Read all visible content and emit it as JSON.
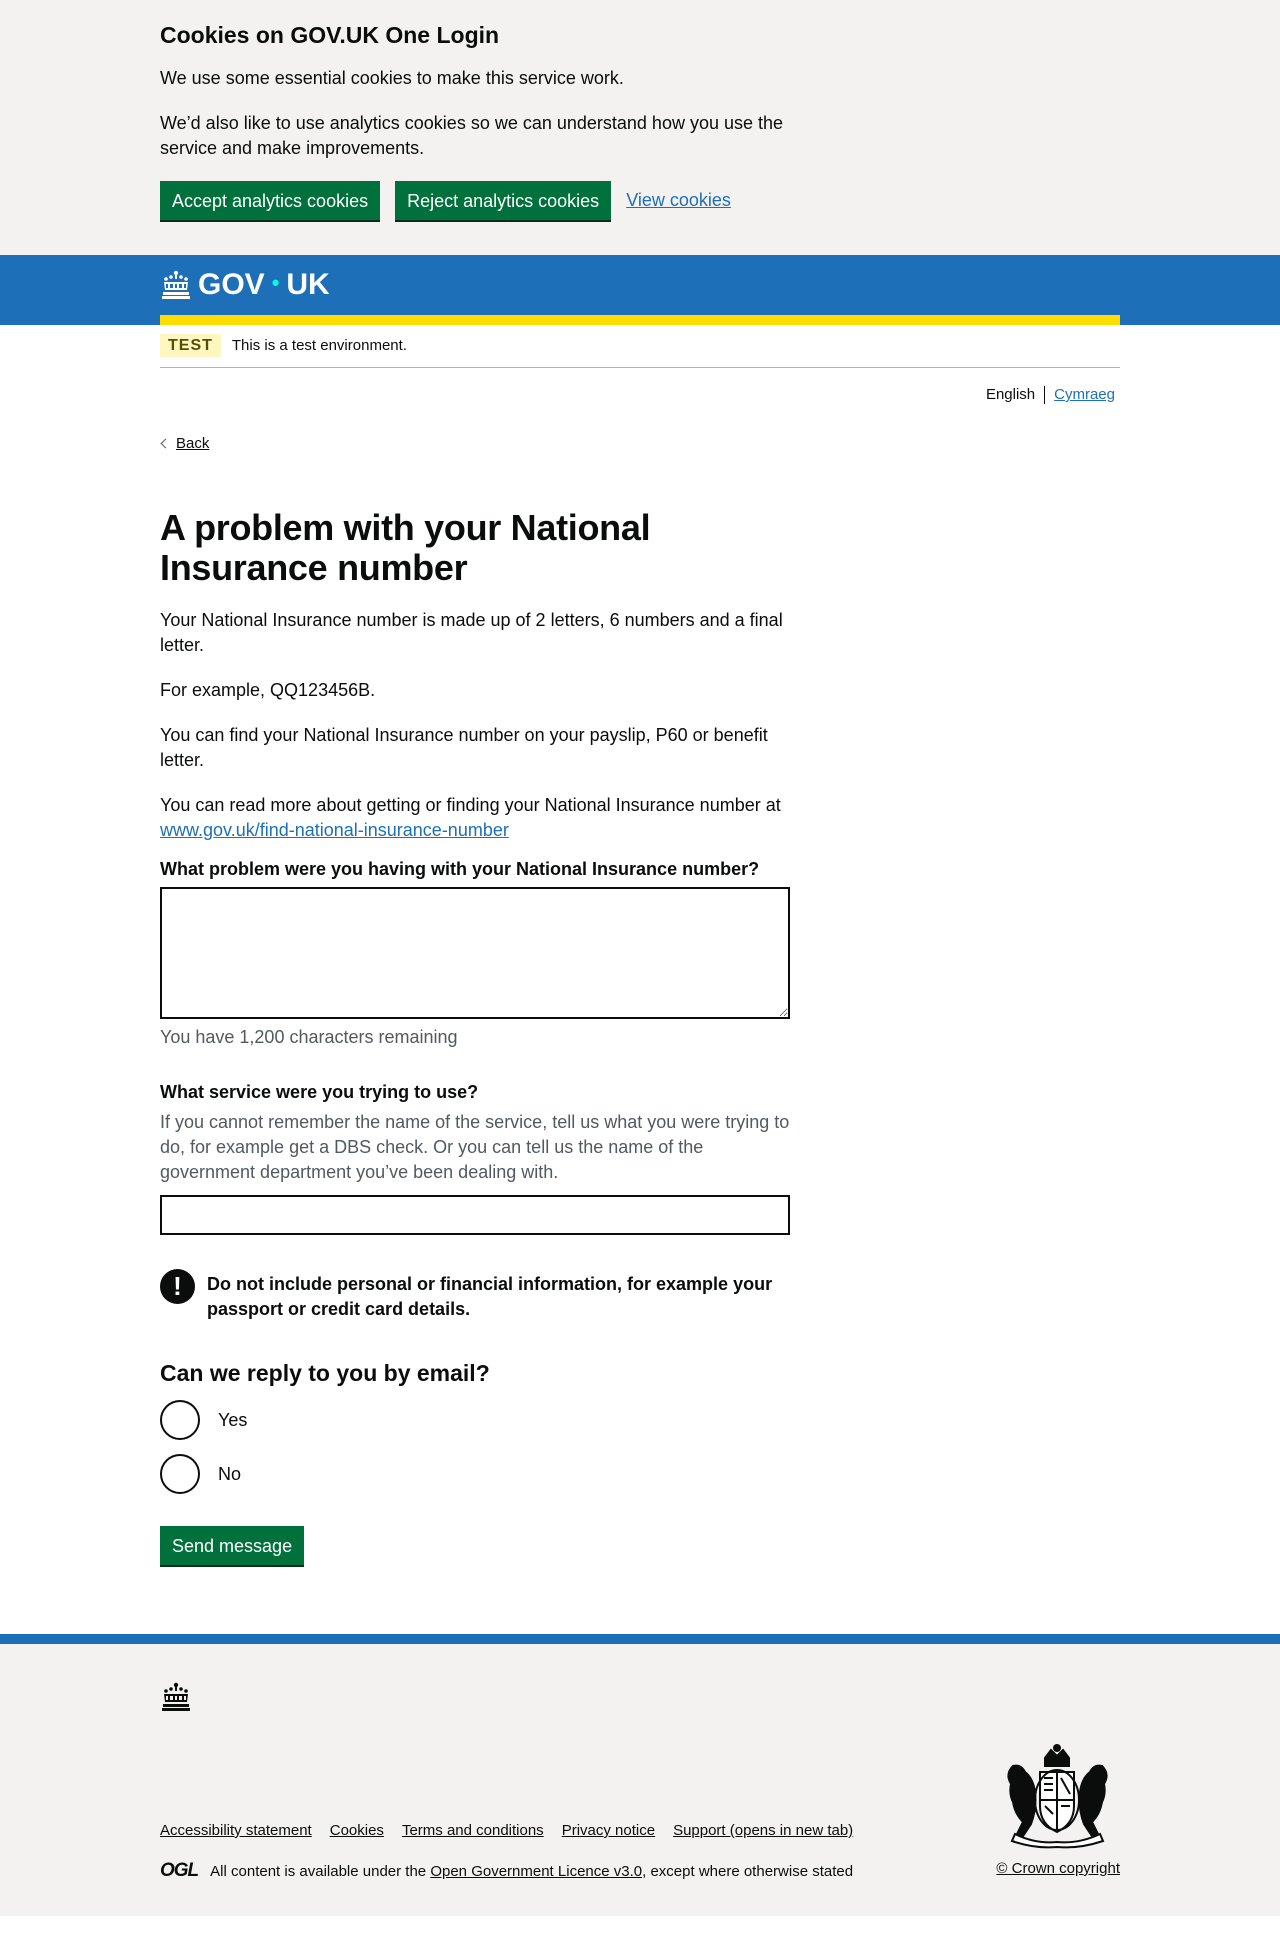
{
  "cookie_banner": {
    "title": "Cookies on GOV.UK One Login",
    "p1": "We use some essential cookies to make this service work.",
    "p2": "We’d also like to use analytics cookies so we can understand how you use the service and make improvements.",
    "accept_label": "Accept analytics cookies",
    "reject_label": "Reject analytics cookies",
    "view_label": "View cookies"
  },
  "header": {
    "logo_gov": "GOV",
    "logo_uk": "UK"
  },
  "phase_banner": {
    "tag": "TEST",
    "text": "This is a test environment."
  },
  "language": {
    "english": "English",
    "welsh": "Cymraeg"
  },
  "back_label": "Back",
  "main": {
    "title": "A problem with your National Insurance number",
    "p1": "Your National Insurance number is made up of 2 letters, 6 numbers and a final letter.",
    "p2": "For example, QQ123456B.",
    "p3": "You can find your National Insurance number on your payslip, P60 or benefit letter.",
    "p4": "You can read more about getting or finding your National Insurance number at",
    "p4_link": "www.gov.uk/find-national-insurance-number",
    "problem_label": "What problem were you having with your National Insurance number?",
    "problem_value": "",
    "counter": "You have 1,200 characters remaining",
    "service_label": "What service were you trying to use?",
    "service_hint": "If you cannot remember the name of the service, tell us what you were trying to do, for example get a DBS check. Or you can tell us the name of the government department you’ve been dealing with.",
    "service_value": "",
    "warning_icon": "!",
    "warning_text": "Do not include personal or financial information, for example your passport or credit card details.",
    "reply_question": "Can we reply to you by email?",
    "radio_yes": "Yes",
    "radio_no": "No",
    "send_label": "Send message"
  },
  "footer": {
    "links": [
      "Accessibility statement",
      "Cookies",
      "Terms and conditions",
      "Privacy notice",
      "Support (opens in new tab)"
    ],
    "ogl": "OGL",
    "licence_prefix": "All content is available under the",
    "licence_link": "Open Government Licence v3.0",
    "licence_suffix": ", except where otherwise stated",
    "copyright": "© Crown copyright"
  },
  "colors": {
    "brand_blue": "#1d70b8",
    "button_green": "#00703c",
    "yellow": "#ffdd00",
    "text": "#0b0c0c",
    "secondary_text": "#505a5f"
  }
}
